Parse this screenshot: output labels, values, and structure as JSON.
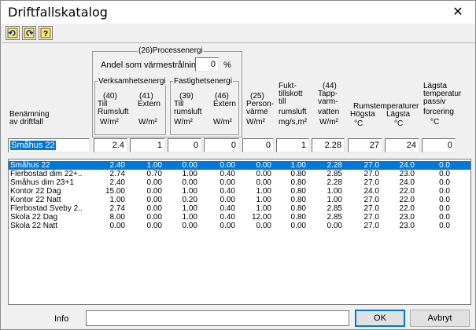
{
  "window": {
    "title": "Driftfallskatalog",
    "close_glyph": "✕"
  },
  "toolbar": {
    "buttons": [
      "undo-icon",
      "redo-icon",
      "help-icon"
    ]
  },
  "headers": {
    "processenergi_title": "(26)Processenergi",
    "andel_label": "Andel som värmestrålning",
    "andel_value": "0",
    "andel_unit": "%",
    "verksamhet_title": "Verksamhetsenergi",
    "v40": "(40)",
    "v40_a": "Till",
    "v40_b": "Rumsluft",
    "v40_unit": "W/m²",
    "v41": "(41)",
    "v41_a": "Extern",
    "v41_unit": "W/m²",
    "fastighet_title": "Fastighetsenergi",
    "f39": "(39)",
    "f39_a": "Till",
    "f39_b": "rumsluft",
    "f39_unit": "W/m²",
    "f46": "(46)",
    "f46_a": "Extern",
    "f46_unit": "W/m²",
    "benamning_a": "Benämning",
    "benamning_b": "av driftfall",
    "p25": "(25)",
    "p25_a": "Person-",
    "p25_b": "värme",
    "p25_unit": "W/m²",
    "fukt_a": "Fukt-",
    "fukt_b": "tillskott",
    "fukt_c": "till",
    "fukt_d": "rumsluft",
    "fukt_unit": "mg/s,m²",
    "t44": "(44)",
    "t44_a": "Tapp-",
    "t44_b": "varm-",
    "t44_c": "vatten",
    "t44_unit": "W/m²",
    "rumstemp": "Rumstemperaturer",
    "hogsta": "Högsta",
    "hogsta_unit": "°C",
    "lagsta": "Lägsta",
    "lagsta_unit": "°C",
    "lp_a": "Lägsta",
    "lp_b": "temperatur",
    "lp_c": "passiv",
    "lp_d": "forcering",
    "lp_unit": "°C"
  },
  "edit": {
    "name": "Småhus 22",
    "values": [
      "2.4",
      "1",
      "0",
      "0",
      "0",
      "1",
      "2.28",
      "27",
      "24",
      "0"
    ]
  },
  "rows": [
    [
      "Småhus 22",
      "2.40",
      "1.00",
      "0.00",
      "0.00",
      "0.00",
      "1.00",
      "2.28",
      "27.0",
      "24.0",
      "0.0"
    ],
    [
      "Flerbostad dim 22+..",
      "2.74",
      "0.70",
      "1.00",
      "0.40",
      "0.00",
      "0.80",
      "2.85",
      "27.0",
      "23.0",
      "0.0"
    ],
    [
      "Småhus dim 23+1",
      "2.40",
      "0.00",
      "0.00",
      "0.00",
      "0.00",
      "0.80",
      "2.28",
      "27.0",
      "24.0",
      "0.0"
    ],
    [
      "Kontor 22 Dag",
      "15.00",
      "0.00",
      "1.00",
      "0.40",
      "1.00",
      "0.80",
      "1.00",
      "24.0",
      "22.0",
      "0.0"
    ],
    [
      "Kontor 22 Natt",
      "1.00",
      "0.00",
      "0.20",
      "0.00",
      "1.00",
      "0.80",
      "1.00",
      "27.0",
      "22.0",
      "0.0"
    ],
    [
      "Flerbostad Sveby 2..",
      "2.74",
      "0.00",
      "1.00",
      "0.40",
      "1.00",
      "0.80",
      "2.85",
      "27.0",
      "22.0",
      "0.0"
    ],
    [
      "Skola 22 Dag",
      "8.00",
      "0.00",
      "1.00",
      "0.40",
      "12.00",
      "0.80",
      "2.85",
      "27.0",
      "23.0",
      "0.0"
    ],
    [
      "Skola 22 Natt",
      "0.00",
      "0.00",
      "0.00",
      "0.00",
      "0.00",
      "0.00",
      "0.00",
      "27.0",
      "23.0",
      "0.0"
    ]
  ],
  "selected_row": 0,
  "footer": {
    "info_label": "Info",
    "info_value": "",
    "ok_label": "OK",
    "cancel_label": "Avbryt"
  },
  "colors": {
    "selection": "#0078d7",
    "background": "#f0f0f0"
  }
}
